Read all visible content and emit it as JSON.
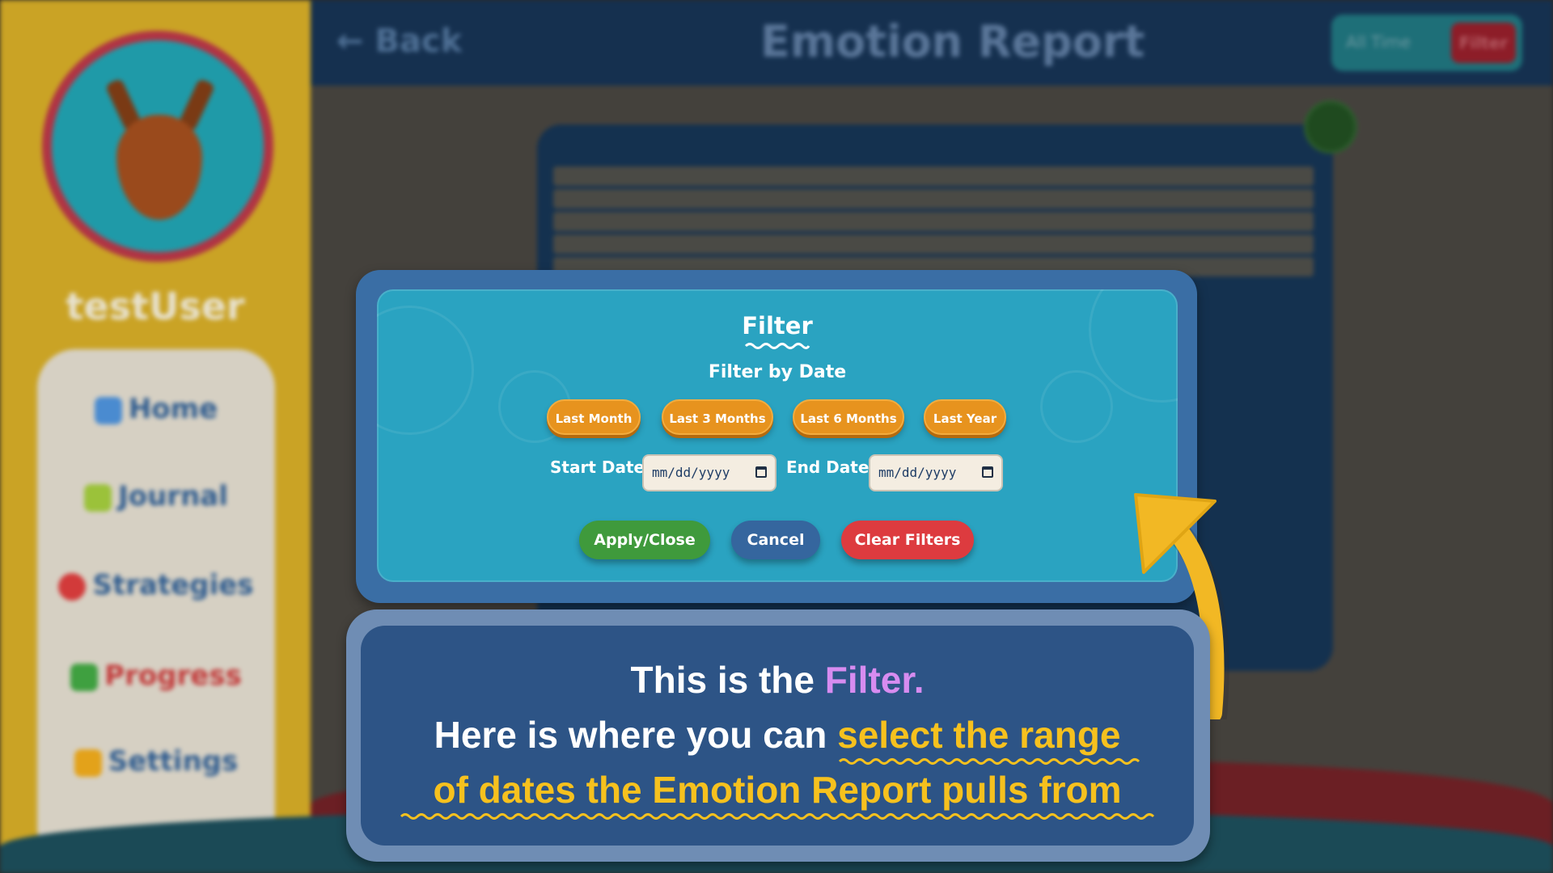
{
  "background": {
    "username": "testUser",
    "nav_items": [
      {
        "label": "Home",
        "icon": "house-icon",
        "color": "#4a8bd0"
      },
      {
        "label": "Journal",
        "icon": "pencil-icon",
        "color": "#9bc23a"
      },
      {
        "label": "Strategies",
        "icon": "lightbulb-icon",
        "color": "#d23a3a"
      },
      {
        "label": "Progress",
        "icon": "chart-icon",
        "color": "#3fa040"
      },
      {
        "label": "Settings",
        "icon": "gear-icon",
        "color": "#e3a21a"
      }
    ],
    "back_label": "Back",
    "title": "Emotion Report",
    "toggle": {
      "all_time": "All Time",
      "filter": "Filter"
    }
  },
  "modal": {
    "title": "Filter",
    "subtitle": "Filter by Date",
    "quick_ranges": [
      "Last Month",
      "Last 3 Months",
      "Last 6 Months",
      "Last Year"
    ],
    "start_label": "Start Date:",
    "start_value": "mm/dd/yyyy",
    "end_label": "End Date:",
    "end_value": "mm/dd/yyyy",
    "apply_label": "Apply/Close",
    "cancel_label": "Cancel",
    "clear_label": "Clear Filters",
    "colors": {
      "apply": "#3f9a3c",
      "cancel": "#35669e",
      "clear": "#dd3b3f",
      "quick": "#e7931e"
    }
  },
  "callout": {
    "line1_a": "This is the ",
    "line1_b": "Filter.",
    "line2_a": "Here is where you can ",
    "line2_b": "select the range",
    "line3": "of dates the Emotion Report pulls from"
  }
}
